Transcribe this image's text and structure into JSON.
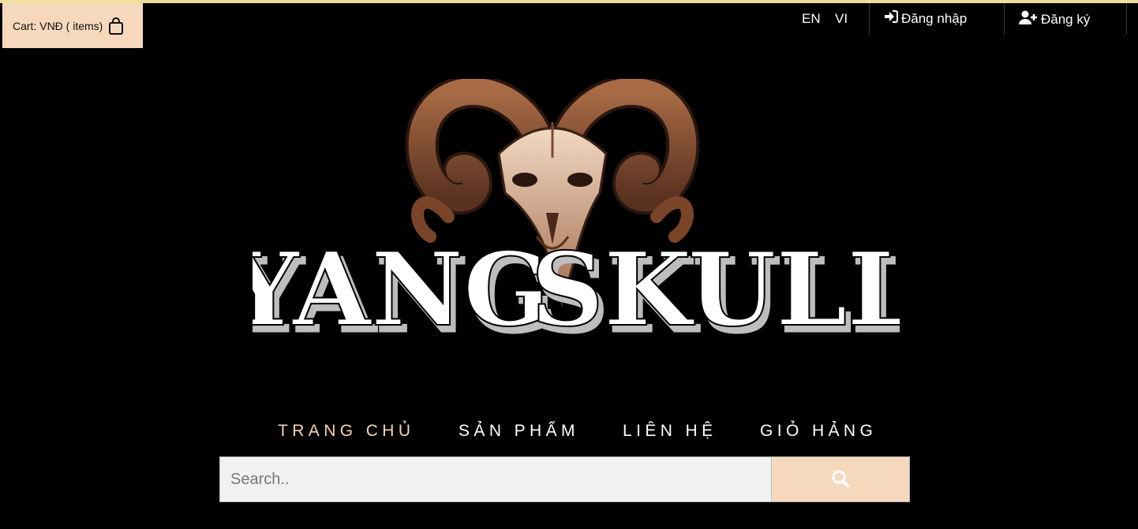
{
  "cart": {
    "label": "Cart: VNĐ ( items)",
    "icon": "shopping-bag-icon"
  },
  "languages": [
    "EN",
    "VI"
  ],
  "auth": {
    "login_label": "Đăng nhập",
    "login_icon": "sign-in-icon",
    "register_label": "Đăng ký",
    "register_icon": "user-plus-icon"
  },
  "logo": {
    "word_left": "YANG",
    "word_right": "SKULL"
  },
  "nav": [
    {
      "label": "TRANG CHỦ",
      "active": true
    },
    {
      "label": "SẢN PHẨM",
      "active": false
    },
    {
      "label": "LIÊN HỆ",
      "active": false
    },
    {
      "label": "GIỎ HẢNG",
      "active": false
    }
  ],
  "search": {
    "placeholder": "Search..",
    "value": "",
    "button_icon": "search-icon"
  },
  "colors": {
    "accent": "#f6d9bd",
    "active_nav": "#f6d3b3",
    "background": "#000000",
    "top_stripe": "#f0df9c"
  }
}
